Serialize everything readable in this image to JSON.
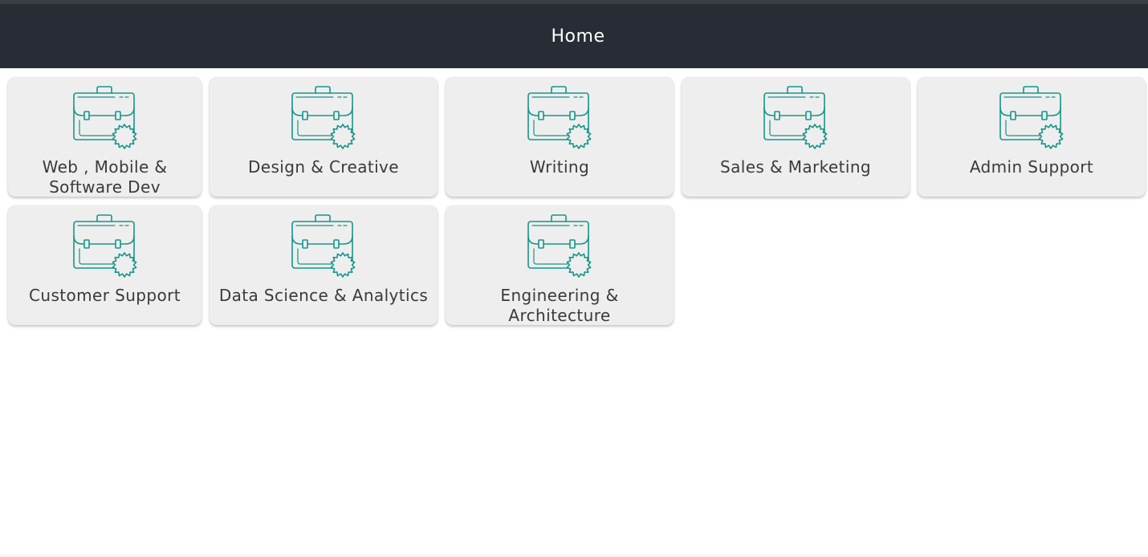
{
  "header": {
    "title": "Home"
  },
  "categories": [
    {
      "label": "Web , Mobile & Software Dev",
      "icon": "briefcase-badge-icon"
    },
    {
      "label": "Design & Creative",
      "icon": "briefcase-badge-icon"
    },
    {
      "label": "Writing",
      "icon": "briefcase-badge-icon"
    },
    {
      "label": "Sales & Marketing",
      "icon": "briefcase-badge-icon"
    },
    {
      "label": "Admin Support",
      "icon": "briefcase-badge-icon"
    },
    {
      "label": "Customer Support",
      "icon": "briefcase-badge-icon"
    },
    {
      "label": "Data Science & Analytics",
      "icon": "briefcase-badge-icon"
    },
    {
      "label": "Engineering & Architecture",
      "icon": "briefcase-badge-icon"
    }
  ],
  "colors": {
    "header_bg": "#282c35",
    "tile_bg": "#eeeeee",
    "icon_accent": "#16958a",
    "label_text": "#3a3a3a"
  }
}
